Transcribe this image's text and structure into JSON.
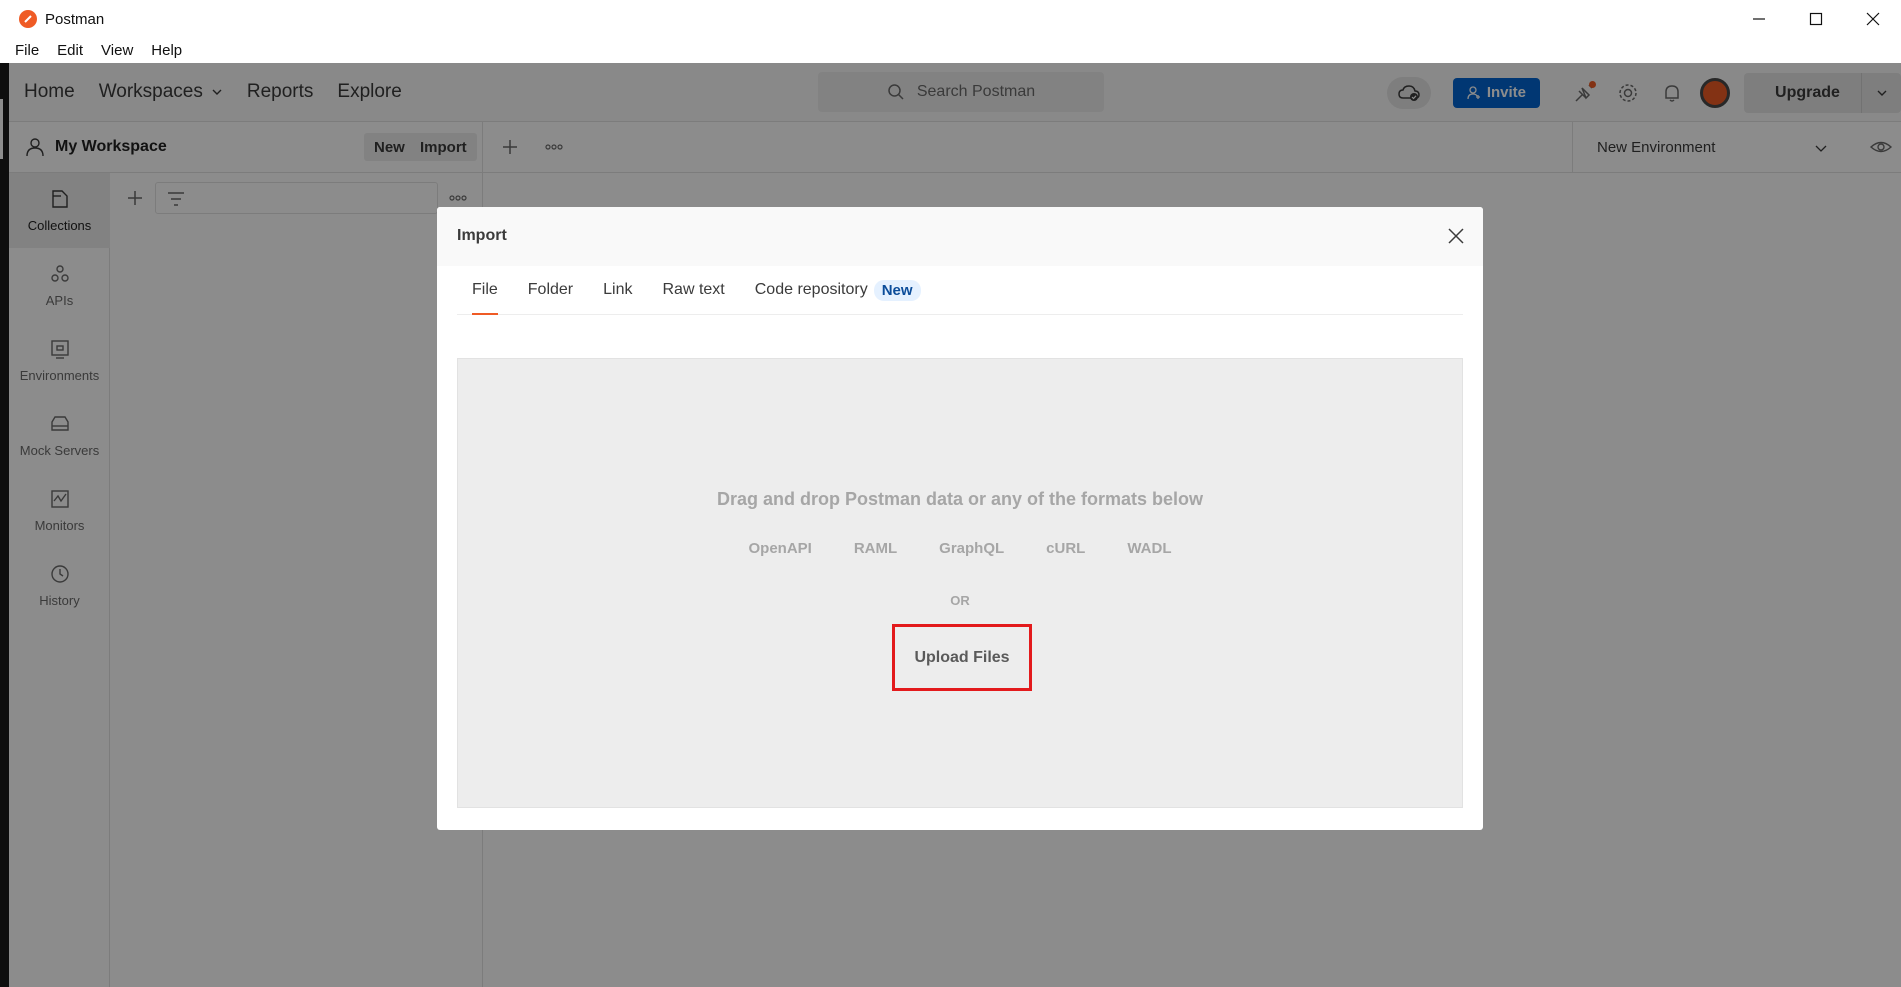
{
  "window": {
    "title": "Postman",
    "controls": [
      "minimize-icon",
      "maximize-icon",
      "close-icon"
    ]
  },
  "menubar": {
    "items": [
      "File",
      "Edit",
      "View",
      "Help"
    ]
  },
  "header": {
    "nav": [
      "Home",
      "Workspaces",
      "Reports",
      "Explore"
    ],
    "search_placeholder": "Search Postman",
    "invite_label": "Invite",
    "upgrade_label": "Upgrade",
    "accent_color": "#ef5b25",
    "invite_color": "#0265d2"
  },
  "workspace": {
    "title": "My Workspace",
    "new_label": "New",
    "import_label": "Import"
  },
  "environment": {
    "selected": "New Environment"
  },
  "sidebar": {
    "items": [
      {
        "label": "Collections",
        "icon": "collections-icon",
        "active": true
      },
      {
        "label": "APIs",
        "icon": "apis-icon",
        "active": false
      },
      {
        "label": "Environments",
        "icon": "environments-icon",
        "active": false
      },
      {
        "label": "Mock Servers",
        "icon": "mock-servers-icon",
        "active": false
      },
      {
        "label": "Monitors",
        "icon": "monitors-icon",
        "active": false
      },
      {
        "label": "History",
        "icon": "history-icon",
        "active": false
      }
    ]
  },
  "modal": {
    "title": "Import",
    "tabs": [
      {
        "label": "File",
        "active": true
      },
      {
        "label": "Folder",
        "active": false
      },
      {
        "label": "Link",
        "active": false
      },
      {
        "label": "Raw text",
        "active": false
      },
      {
        "label": "Code repository",
        "active": false
      }
    ],
    "new_badge": "New",
    "dropzone": {
      "title": "Drag and drop Postman data or any of the formats below",
      "formats": [
        "OpenAPI",
        "RAML",
        "GraphQL",
        "cURL",
        "WADL"
      ],
      "or_label": "OR",
      "upload_label": "Upload Files",
      "highlight_color": "#e31a1c"
    }
  }
}
